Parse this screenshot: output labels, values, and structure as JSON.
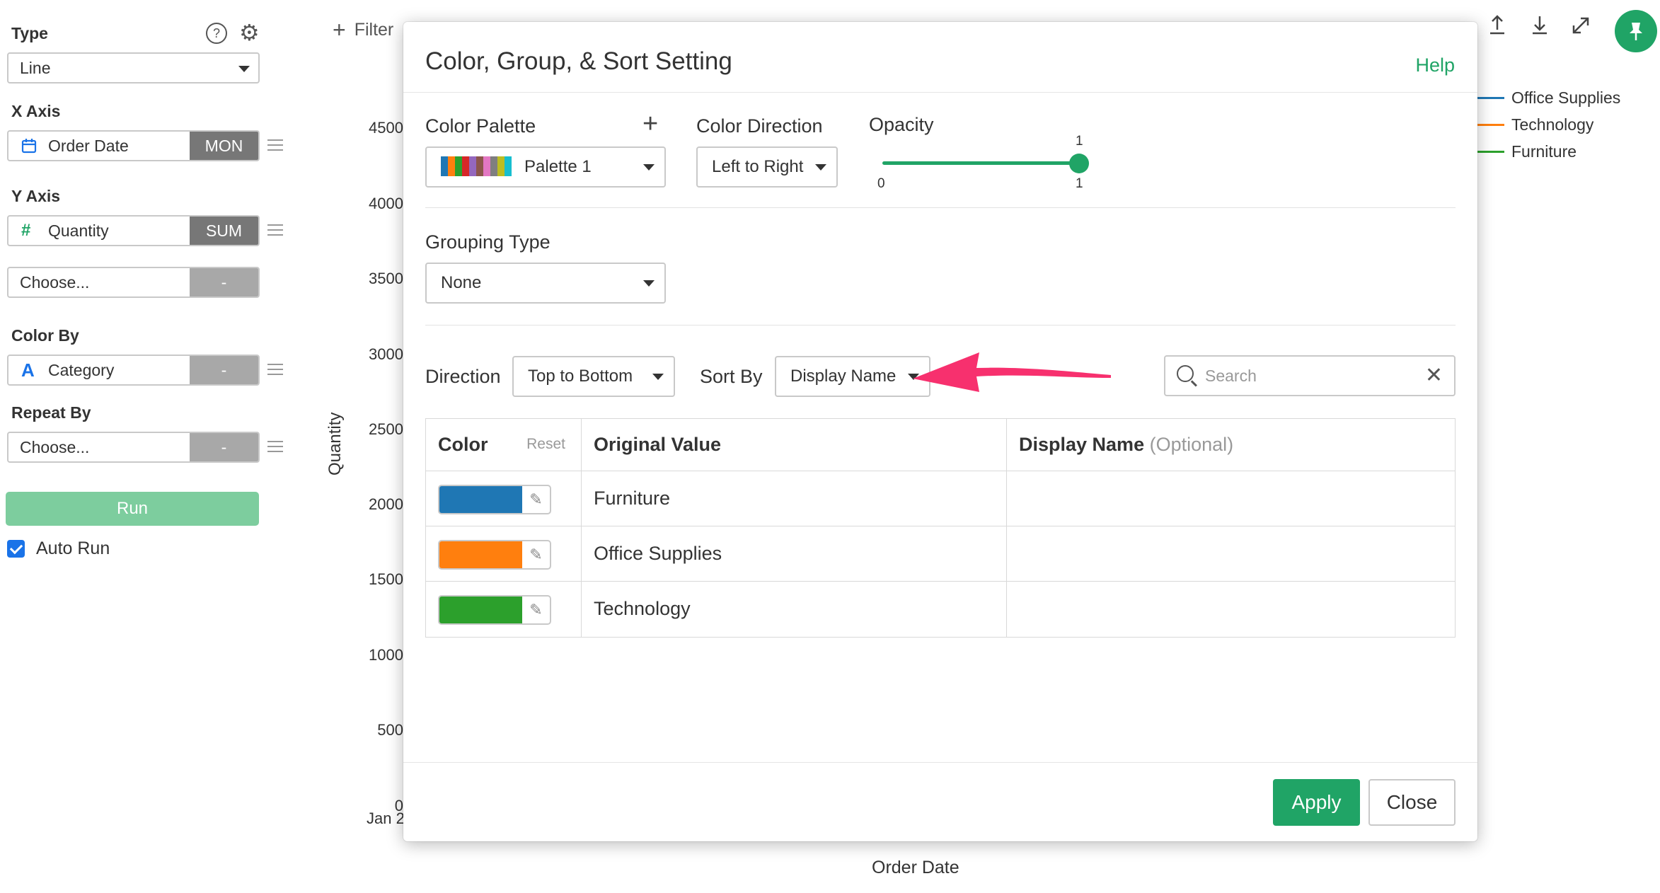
{
  "left_panel": {
    "type_title": "Type",
    "help_icon_glyph": "?",
    "type_value": "Line",
    "x_axis_title": "X Axis",
    "x_axis_field": "Order Date",
    "x_axis_agg": "MON",
    "y_axis_title": "Y Axis",
    "y_axis_field": "Quantity",
    "y_axis_agg": "SUM",
    "y_axis2_placeholder": "Choose...",
    "y_axis2_agg": "-",
    "color_by_title": "Color By",
    "color_by_field": "Category",
    "color_by_agg": "-",
    "repeat_by_title": "Repeat By",
    "repeat_by_placeholder": "Choose...",
    "repeat_by_agg": "-",
    "run_label": "Run",
    "auto_run_label": "Auto Run",
    "icons": {
      "number": "#",
      "text": "A"
    }
  },
  "chart": {
    "filter_label": "Filter",
    "y_ticks": [
      "4500",
      "4000",
      "3500",
      "3000",
      "2500",
      "2000",
      "1500",
      "1000",
      "500",
      "0"
    ],
    "x_tick": "Jan 2",
    "y_axis_label": "Quantity",
    "x_axis_label": "Order Date",
    "legend": [
      {
        "name": "Office Supplies",
        "color": "#1f77b4"
      },
      {
        "name": "Technology",
        "color": "#ff7f0e"
      },
      {
        "name": "Furniture",
        "color": "#2ca02c"
      }
    ]
  },
  "modal": {
    "title": "Color, Group, & Sort Setting",
    "help_label": "Help",
    "color_palette_label": "Color Palette",
    "palette_value": "Palette 1",
    "palette_swatches": [
      "#1f77b4",
      "#ff7f0e",
      "#2ca02c",
      "#d62728",
      "#9467bd",
      "#8c564b",
      "#e377c2",
      "#7f7f7f",
      "#bcbd22",
      "#17becf"
    ],
    "color_direction_label": "Color Direction",
    "color_direction_value": "Left to Right",
    "opacity_label": "Opacity",
    "opacity_value": "1",
    "opacity_min": "0",
    "opacity_max": "1",
    "grouping_type_label": "Grouping Type",
    "grouping_type_value": "None",
    "direction_label": "Direction",
    "direction_value": "Top to Bottom",
    "sort_by_label": "Sort By",
    "sort_by_value": "Display Name",
    "search_placeholder": "Search",
    "table": {
      "col_color": "Color",
      "col_reset": "Reset",
      "col_original": "Original Value",
      "col_display": "Display Name",
      "col_display_optional": "(Optional)",
      "rows": [
        {
          "color": "#1f77b4",
          "original": "Furniture",
          "display": ""
        },
        {
          "color": "#ff7f0e",
          "original": "Office Supplies",
          "display": ""
        },
        {
          "color": "#2ca02c",
          "original": "Technology",
          "display": ""
        }
      ]
    },
    "apply_label": "Apply",
    "close_label": "Close",
    "arrow_color": "#f7306e"
  }
}
